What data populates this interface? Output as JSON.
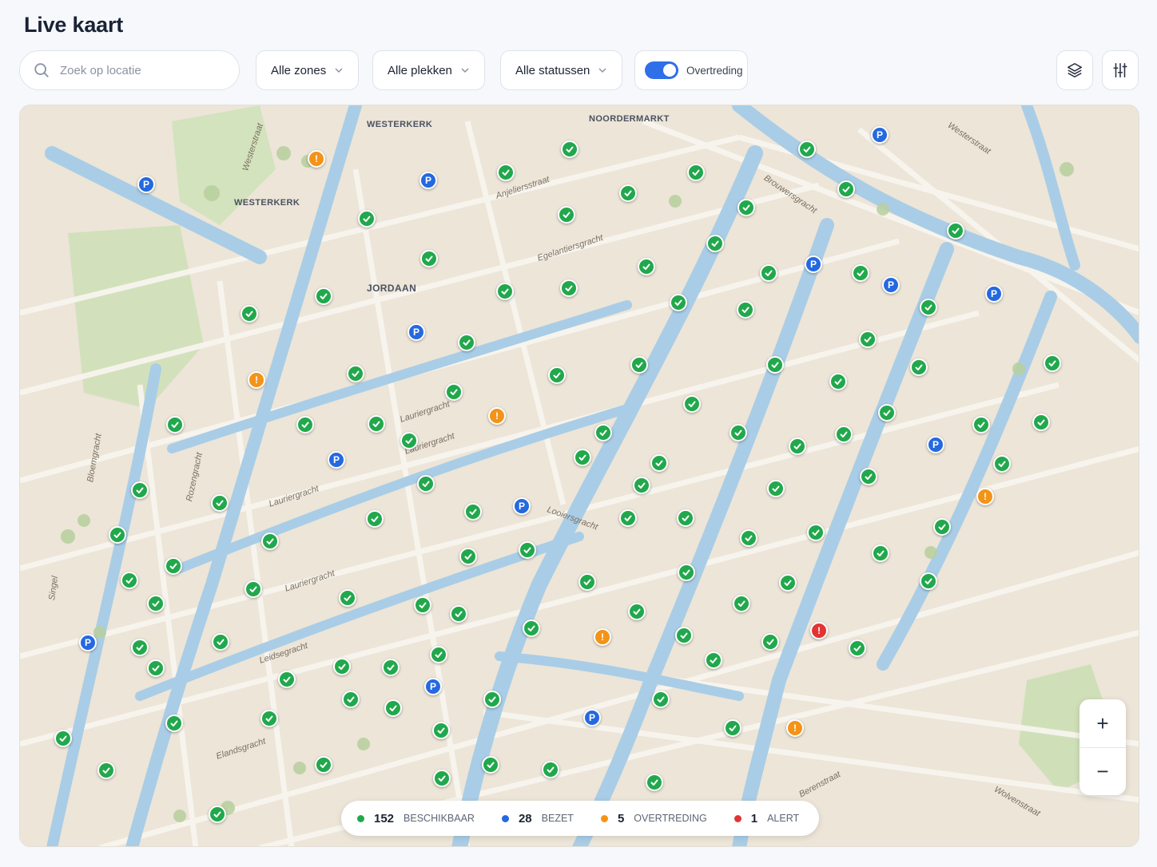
{
  "page": {
    "title": "Live kaart"
  },
  "toolbar": {
    "search_placeholder": "Zoek op locatie",
    "zones_label": "Alle zones",
    "spots_label": "Alle plekken",
    "status_label": "Alle statussen",
    "toggle_label": "Overtreding",
    "toggle_on": true
  },
  "map": {
    "pois": [
      "WESTERKERK",
      "WESTERKERK",
      "NOORDERMARKT",
      "JORDAAN"
    ],
    "streets": [
      "Westerstraat",
      "Anjeliersstraat",
      "Egelantiersgracht",
      "Westerstraat",
      "Brouwersgracht",
      "Lauriergracht",
      "Lauriergracht",
      "Lauriergracht",
      "Lauriergracht",
      "Leidsegracht",
      "Elandsgracht",
      "Rozengracht",
      "Looiersgracht",
      "Berenstraat",
      "Wolvenstraat",
      "Bloemgracht",
      "Singel"
    ],
    "zoom_in": "+",
    "zoom_out": "−"
  },
  "legend": [
    {
      "count": "152",
      "label": "BESCHIKBAAR",
      "color": "#22a84c"
    },
    {
      "count": "28",
      "label": "BEZET",
      "color": "#2569e0"
    },
    {
      "count": "5",
      "label": "OVERTREDING",
      "color": "#f39318"
    },
    {
      "count": "1",
      "label": "ALERT",
      "color": "#e23434"
    }
  ],
  "icons": {
    "search": "search-icon",
    "layers": "layers-icon",
    "filters": "sliders-icon",
    "ok": "check-icon",
    "parking": "P",
    "warn": "!",
    "alert": "!"
  }
}
